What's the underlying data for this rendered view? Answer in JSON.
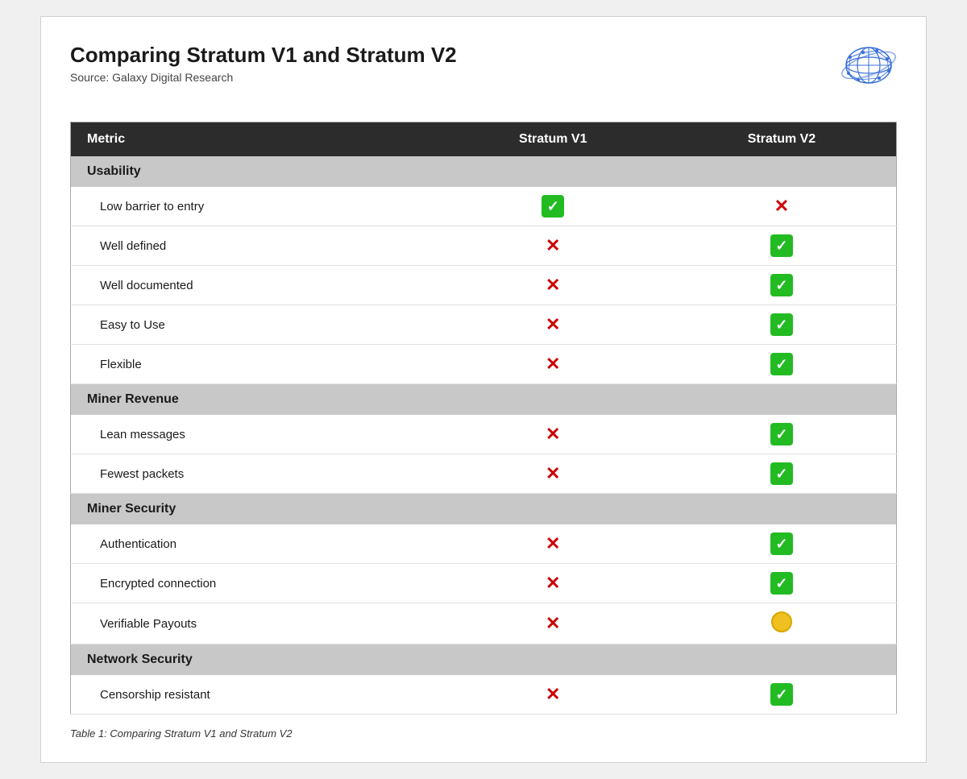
{
  "page": {
    "title": "Comparing Stratum V1 and Stratum V2",
    "source": "Source: Galaxy Digital Research",
    "caption": "Table 1: Comparing Stratum V1 and Stratum V2"
  },
  "table": {
    "headers": [
      "Metric",
      "Stratum V1",
      "Stratum V2"
    ],
    "sections": [
      {
        "label": "Usability",
        "rows": [
          {
            "metric": "Low barrier to entry",
            "v1": "check",
            "v2": "cross"
          },
          {
            "metric": "Well defined",
            "v1": "cross",
            "v2": "check"
          },
          {
            "metric": "Well documented",
            "v1": "cross",
            "v2": "check"
          },
          {
            "metric": "Easy to Use",
            "v1": "cross",
            "v2": "check"
          },
          {
            "metric": "Flexible",
            "v1": "cross",
            "v2": "check"
          }
        ]
      },
      {
        "label": "Miner Revenue",
        "rows": [
          {
            "metric": "Lean messages",
            "v1": "cross",
            "v2": "check"
          },
          {
            "metric": "Fewest packets",
            "v1": "cross",
            "v2": "check"
          }
        ]
      },
      {
        "label": "Miner Security",
        "rows": [
          {
            "metric": "Authentication",
            "v1": "cross",
            "v2": "check"
          },
          {
            "metric": "Encrypted connection",
            "v1": "cross",
            "v2": "check"
          },
          {
            "metric": "Verifiable Payouts",
            "v1": "cross",
            "v2": "circle"
          }
        ]
      },
      {
        "label": "Network Security",
        "rows": [
          {
            "metric": "Censorship resistant",
            "v1": "cross",
            "v2": "check"
          }
        ]
      }
    ]
  }
}
